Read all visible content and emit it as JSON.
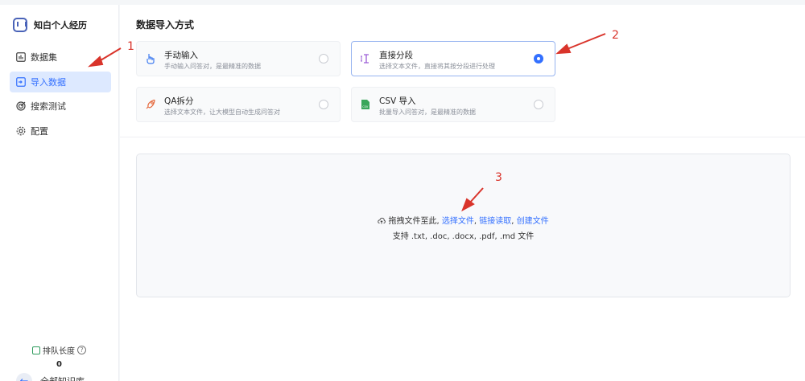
{
  "brand": {
    "name": "知白个人经历"
  },
  "nav": [
    {
      "label": "数据集",
      "icon": "bar-chart-icon"
    },
    {
      "label": "导入数据",
      "icon": "import-icon",
      "active": true
    },
    {
      "label": "搜索测试",
      "icon": "target-icon"
    },
    {
      "label": "配置",
      "icon": "gear-icon"
    }
  ],
  "queue": {
    "label": "排队长度",
    "value": "0"
  },
  "back": {
    "label": "全部知识库"
  },
  "main": {
    "title": "数据导入方式",
    "options": [
      {
        "title": "手动输入",
        "desc": "手动输入问答对，是最精准的数据",
        "icon": "hand-pointer-icon",
        "selected": false
      },
      {
        "title": "直接分段",
        "desc": "选择文本文件，直接将其按分段进行处理",
        "icon": "text-cursor-icon",
        "selected": true
      },
      {
        "title": "QA拆分",
        "desc": "选择文本文件，让大模型自动生成问答对",
        "icon": "rocket-icon",
        "selected": false
      },
      {
        "title": "CSV 导入",
        "desc": "批量导入问答对，是最精准的数据",
        "icon": "csv-file-icon",
        "selected": false
      }
    ],
    "dropzone": {
      "prefix": "拖拽文件至此,",
      "link_select": "选择文件",
      "link_url": "链接读取",
      "link_create": "创建文件",
      "sep": ",",
      "support": "支持 .txt, .doc, .docx, .pdf, .md 文件"
    }
  },
  "annotations": {
    "a1": "1",
    "a2": "2",
    "a3": "3",
    "color": "#d9342b"
  },
  "colors": {
    "accent": "#3370ff",
    "active_bg": "#dde9ff"
  }
}
